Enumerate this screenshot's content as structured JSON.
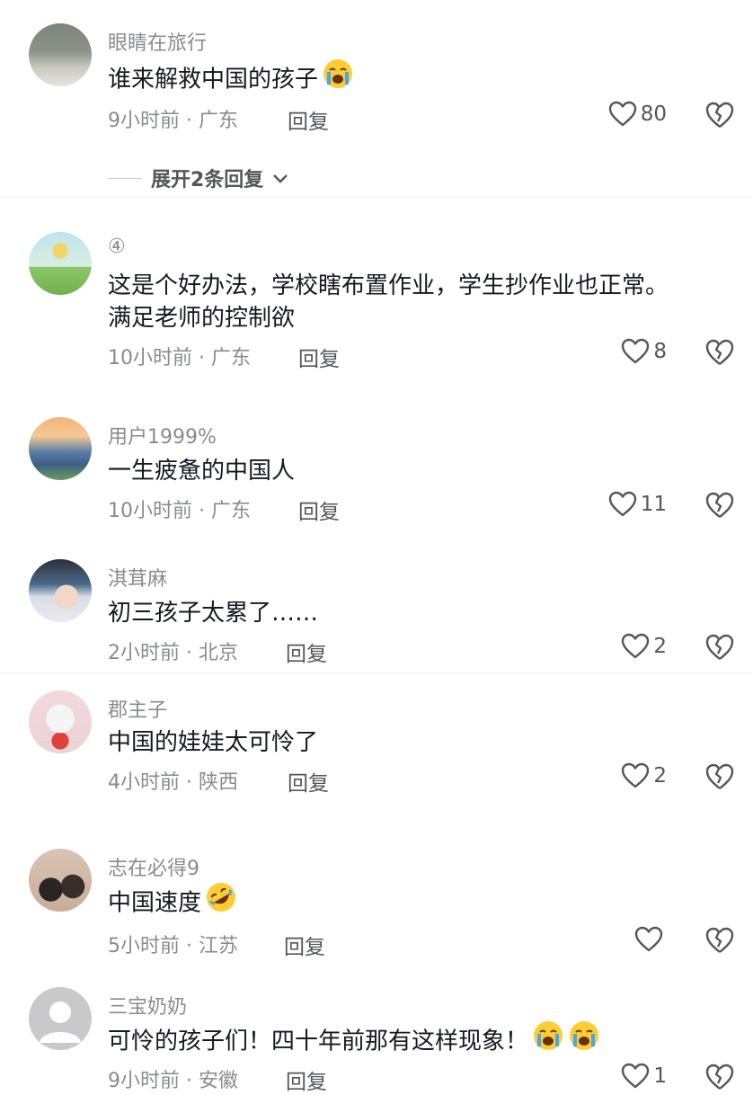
{
  "comments": [
    {
      "username": "眼睛在旅行",
      "text": "谁来解救中国的孩子",
      "time": "9小时前",
      "location": "广东",
      "reply": "回复",
      "likes": "80",
      "emojis": [
        "crying-face"
      ]
    },
    {
      "username": "④",
      "text": "这是个好办法，学校瞎布置作业，学生抄作业也正常。",
      "text2": "满足老师的控制欲",
      "time": "10小时前",
      "location": "广东",
      "reply": "回复",
      "likes": "8",
      "emojis": []
    },
    {
      "username": "用户1999%",
      "text": "一生疲惫的中国人",
      "time": "10小时前",
      "location": "广东",
      "reply": "回复",
      "likes": "11",
      "emojis": []
    },
    {
      "username": "淇茸麻",
      "text": "初三孩子太累了……",
      "time": "2小时前",
      "location": "北京",
      "reply": "回复",
      "likes": "2",
      "emojis": []
    },
    {
      "username": "郡主子",
      "text": "中国的娃娃太可怜了",
      "time": "4小时前",
      "location": "陕西",
      "reply": "回复",
      "likes": "2",
      "emojis": []
    },
    {
      "username": "志在必得9",
      "text": "中国速度",
      "time": "5小时前",
      "location": "江苏",
      "reply": "回复",
      "likes": "",
      "emojis": [
        "rofl-face"
      ]
    },
    {
      "username": "三宝奶奶",
      "text": "可怜的孩子们！四十年前那有这样现象！",
      "time": "9小时前",
      "location": "安徽",
      "reply": "回复",
      "likes": "1",
      "emojis": [
        "crying-face",
        "crying-face"
      ]
    }
  ],
  "expand_replies": "展开2条回复",
  "meta_separator": " · ",
  "colors": {
    "text": "#161823",
    "secondary": "#8a8b91",
    "icon": "#55565c"
  }
}
